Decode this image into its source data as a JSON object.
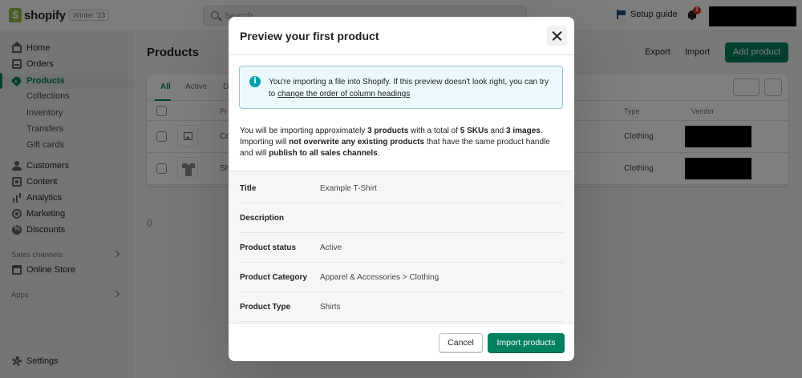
{
  "app": {
    "logo_text": "shopify",
    "edition": "Winter '23",
    "search_placeholder": "Search",
    "setup_guide": "Setup guide",
    "notification_count": "1"
  },
  "sidebar": {
    "items": [
      {
        "label": "Home",
        "icon": "home-icon"
      },
      {
        "label": "Orders",
        "icon": "orders-icon"
      },
      {
        "label": "Products",
        "icon": "tag-icon"
      },
      {
        "label": "Customers",
        "icon": "person-icon"
      },
      {
        "label": "Content",
        "icon": "content-icon"
      },
      {
        "label": "Analytics",
        "icon": "chart-icon"
      },
      {
        "label": "Marketing",
        "icon": "target-icon"
      },
      {
        "label": "Discounts",
        "icon": "discount-icon"
      }
    ],
    "product_sub_items": [
      "Collections",
      "Inventory",
      "Transfers",
      "Gift cards"
    ],
    "sales_channels_label": "Sales channels",
    "online_store": "Online Store",
    "apps_label": "Apps",
    "settings": "Settings"
  },
  "page": {
    "title": "Products",
    "export": "Export",
    "import": "Import",
    "add_product": "Add product",
    "tabs": [
      "All",
      "Active",
      "D"
    ],
    "columns": {
      "product": "Pr",
      "type": "Type",
      "vendor": "Vendor"
    },
    "rows": [
      {
        "name": "Co",
        "type": "Clothing",
        "thumb": "image-placeholder-icon"
      },
      {
        "name": "Sh",
        "type": "Clothing",
        "thumb": "tshirt-icon"
      }
    ],
    "empty_marker": "()"
  },
  "modal": {
    "title": "Preview your first product",
    "banner_text": "You're importing a file into Shopify. If this preview doesn't look right, you can try to ",
    "banner_link": "change the order of column headings",
    "summary": {
      "p1": "You will be importing approximately ",
      "products": "3 products",
      "p2": " with a total of ",
      "skus": "5 SKUs",
      "p3": " and ",
      "images": "3 images",
      "p4": ". Importing will ",
      "overwrite": "not overwrite any existing products",
      "p5": " that have the same product handle and will ",
      "publish": "publish to all sales channels",
      "p6": "."
    },
    "details": [
      {
        "label": "Title",
        "value": "Example T-Shirt"
      },
      {
        "label": "Description",
        "value": ""
      },
      {
        "label": "Product status",
        "value": "Active"
      },
      {
        "label": "Product Category",
        "value": "Apparel & Accessories > Clothing"
      },
      {
        "label": "Product Type",
        "value": "Shirts"
      }
    ],
    "cancel": "Cancel",
    "import_button": "Import products"
  },
  "colors": {
    "accent": "#008060",
    "banner_bg": "#ebf9fc",
    "info": "#00a0ac",
    "badge": "#d72c0d"
  }
}
